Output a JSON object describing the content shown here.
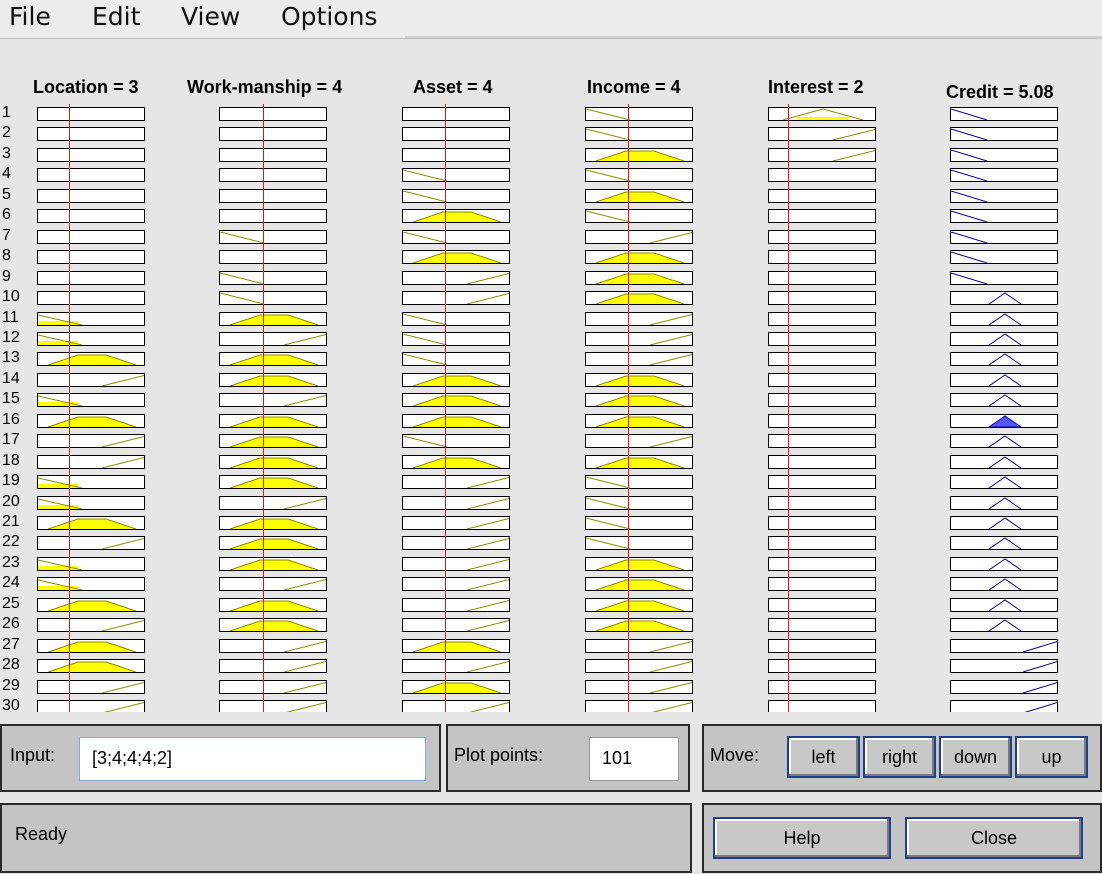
{
  "menu": {
    "file": "File",
    "edit": "Edit",
    "view": "View",
    "options": "Options"
  },
  "columns": [
    {
      "title": "Location = 3",
      "input_value": 3
    },
    {
      "title": "Work-manship = 4",
      "input_value": 4
    },
    {
      "title": "Asset = 4",
      "input_value": 4
    },
    {
      "title": "Income = 4",
      "input_value": 4
    },
    {
      "title": "Interest = 2",
      "input_value": 2
    }
  ],
  "output_column": {
    "title": "Credit = 5.08",
    "output_value": 5.08
  },
  "rules": {
    "count_visible": 30,
    "numbers": [
      "1",
      "2",
      "3",
      "4",
      "5",
      "6",
      "7",
      "8",
      "9",
      "10",
      "11",
      "12",
      "13",
      "14",
      "15",
      "16",
      "17",
      "18",
      "19",
      "20",
      "21",
      "22",
      "23",
      "24",
      "25",
      "26",
      "27",
      "28",
      "29",
      "30"
    ]
  },
  "input_panel": {
    "label": "Input:",
    "value": "[3;4;4;4;2]"
  },
  "plot_panel": {
    "label": "Plot points:",
    "value": "101"
  },
  "move_panel": {
    "label": "Move:",
    "left": "left",
    "right": "right",
    "down": "down",
    "up": "up"
  },
  "status": {
    "text": "Ready"
  },
  "buttons": {
    "help": "Help",
    "close": "Close"
  },
  "colors": {
    "fill": "#ffff00",
    "outline": "#8b8b00",
    "red_line": "#e11111",
    "output_line": "#0000a0",
    "output_fill": "#5555ff"
  }
}
